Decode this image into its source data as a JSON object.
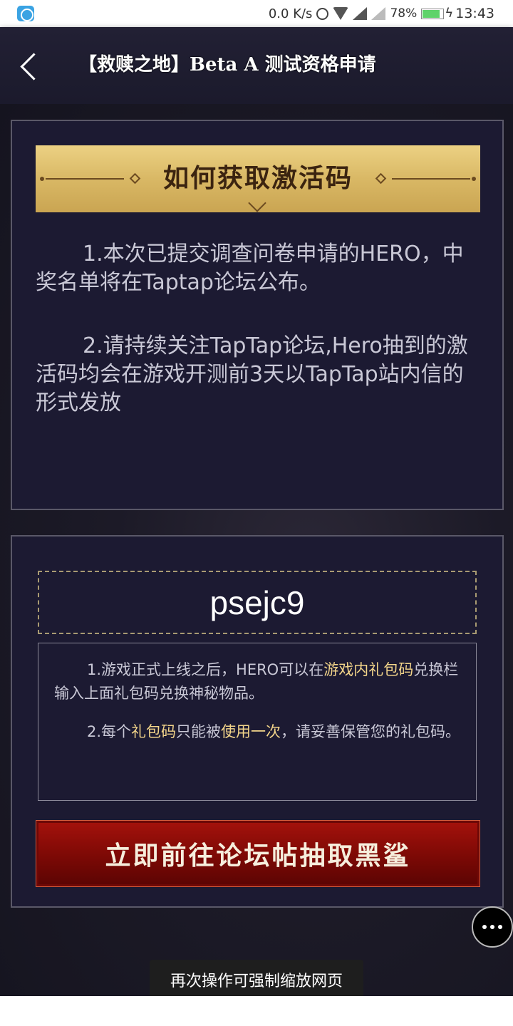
{
  "status_bar": {
    "network_speed": "0.0 K/s",
    "battery_percent": "78%",
    "time": "13:43"
  },
  "header": {
    "title": "【救赎之地】Beta A 测试资格申请"
  },
  "banner": {
    "title": "如何获取激活码"
  },
  "info": {
    "item1": "1.本次已提交调查问卷申请的HERO，中奖名单将在Taptap论坛公布。",
    "item2": "2.请持续关注TapTap论坛,Hero抽到的激活码均会在游戏开测前3天以TapTap站内信的形式发放"
  },
  "code": {
    "value": "psejc9"
  },
  "notes": {
    "note1_a": "1.游戏正式上线之后，HERO可以在",
    "note1_hl": "游戏内礼包码",
    "note1_b": "兑换栏输入上面礼包码兑换神秘物品。",
    "note2_a": "2.每个",
    "note2_hl1": "礼包码",
    "note2_b": "只能被",
    "note2_hl2": "使用一次",
    "note2_c": "，请妥善保管您的礼包码。"
  },
  "cta": {
    "label": "立即前往论坛帖抽取黑鲨"
  },
  "toast": {
    "text": "再次操作可强制缩放网页"
  },
  "colors": {
    "highlight": "#f3d58a",
    "button_red": "#8a0a06",
    "banner_gold": "#dcbb68",
    "panel_bg": "#1c1a32"
  }
}
